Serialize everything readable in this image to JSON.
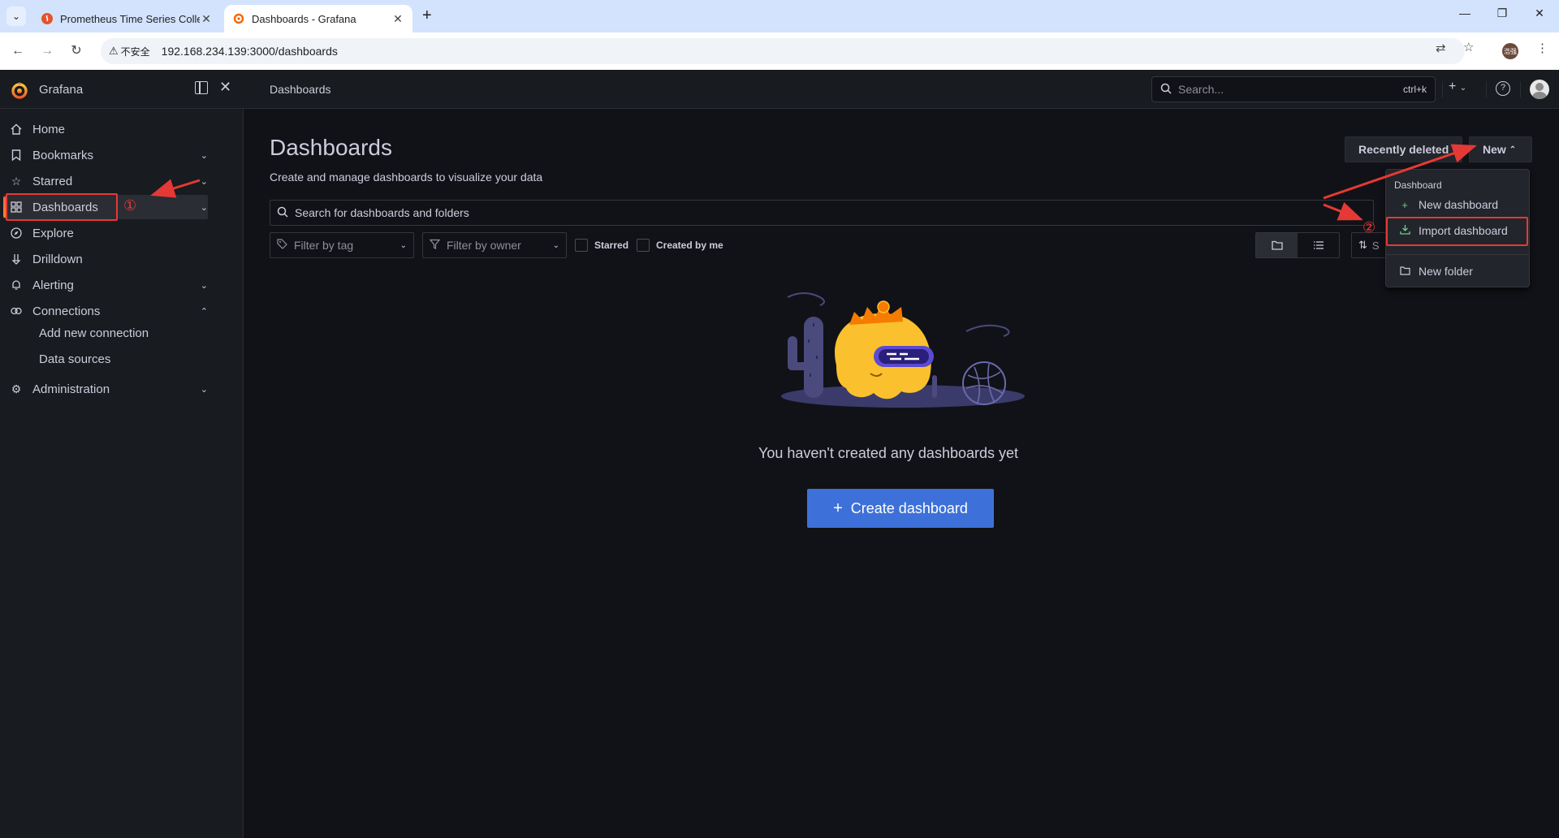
{
  "browser": {
    "tabs": [
      {
        "title": "Prometheus Time Series Colle",
        "active": false
      },
      {
        "title": "Dashboards - Grafana",
        "active": true
      }
    ],
    "security_label": "不安全",
    "url": "192.168.234.139:3000/dashboards",
    "profile_initials": "浩强"
  },
  "grafana": {
    "brand": "Grafana",
    "breadcrumb": "Dashboards",
    "search": {
      "placeholder": "Search...",
      "shortcut": "ctrl+k"
    },
    "sidebar": {
      "items": [
        {
          "label": "Home",
          "icon": "home-icon"
        },
        {
          "label": "Bookmarks",
          "icon": "bookmark-icon"
        },
        {
          "label": "Starred",
          "icon": "star-icon"
        },
        {
          "label": "Dashboards",
          "icon": "apps-icon"
        },
        {
          "label": "Explore",
          "icon": "compass-icon"
        },
        {
          "label": "Drilldown",
          "icon": "drilldown-icon"
        },
        {
          "label": "Alerting",
          "icon": "bell-icon"
        },
        {
          "label": "Connections",
          "icon": "link-icon"
        },
        {
          "label": "Administration",
          "icon": "cog-icon"
        }
      ],
      "sub_items": [
        "Add new connection",
        "Data sources"
      ]
    },
    "page": {
      "title": "Dashboards",
      "subtitle": "Create and manage dashboards to visualize your data",
      "recently_deleted": "Recently deleted",
      "new_button": "New",
      "search_placeholder": "Search for dashboards and folders",
      "filter_tag": "Filter by tag",
      "filter_owner": "Filter by owner",
      "starred": "Starred",
      "created_by_me": "Created by me",
      "sort_label": "S",
      "empty_text": "You haven't created any dashboards yet",
      "create_button": "Create dashboard"
    },
    "new_menu": {
      "group": "Dashboard",
      "items": [
        "New dashboard",
        "Import dashboard",
        "New folder"
      ]
    }
  },
  "annotations": {
    "step1": "①",
    "step2": "②"
  },
  "colors": {
    "accent": "#3d71d9",
    "annotation": "#e53935",
    "background": "#111217"
  }
}
